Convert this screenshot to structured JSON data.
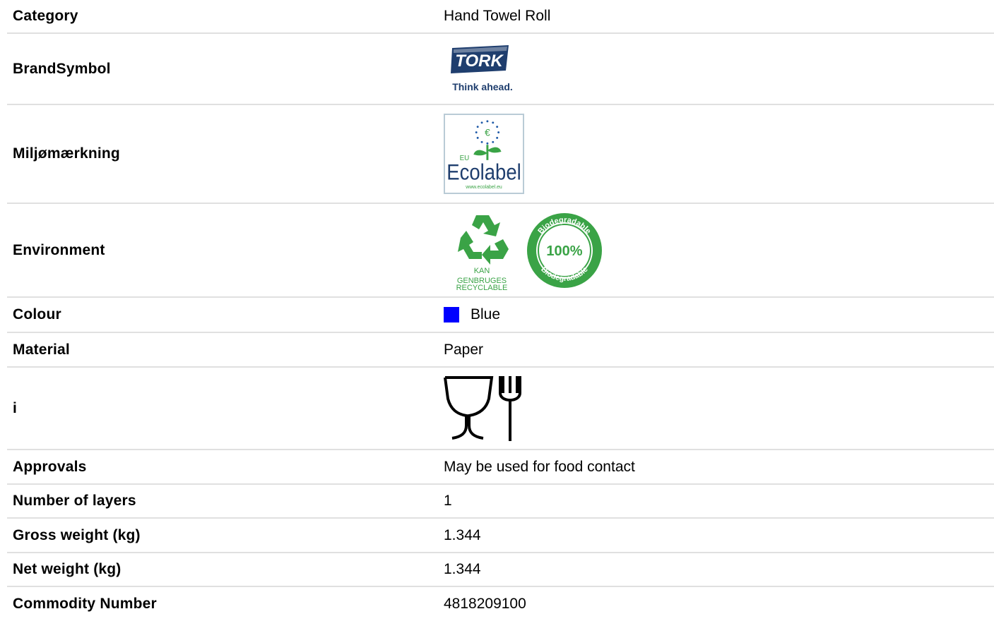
{
  "rows": [
    {
      "label": "Category",
      "value": "Hand Towel Roll"
    },
    {
      "label": "BrandSymbol",
      "logo": {
        "name": "TORK",
        "tagline": "Think ahead."
      }
    },
    {
      "label": "Miljømærkning",
      "logo": {
        "eu": "EU",
        "name": "Ecolabel",
        "url": "www.ecolabel.eu"
      }
    },
    {
      "label": "Environment",
      "recycle": {
        "line1": "KAN",
        "line2": "GENBRUGES",
        "line3": "RECYCLABLE"
      },
      "bio": {
        "percent": "100%",
        "top": "Biodegradable",
        "bottom": "Biodegradable"
      }
    },
    {
      "label": "Colour",
      "value": "Blue",
      "swatch_color": "#0000ff"
    },
    {
      "label": "Material",
      "value": "Paper"
    },
    {
      "label": "i",
      "icon": "food-safe-glass-fork-icon"
    },
    {
      "label": "Approvals",
      "value": "May be used for food contact"
    },
    {
      "label": "Number of layers",
      "value": "1"
    },
    {
      "label": "Gross weight (kg)",
      "value": "1.344"
    },
    {
      "label": "Net weight (kg)",
      "value": "1.344"
    },
    {
      "label": "Commodity Number",
      "value": "4818209100"
    }
  ],
  "colors": {
    "tork_navy": "#1f3e6e",
    "eco_green": "#3aa346",
    "divider": "#e0e0e0"
  }
}
